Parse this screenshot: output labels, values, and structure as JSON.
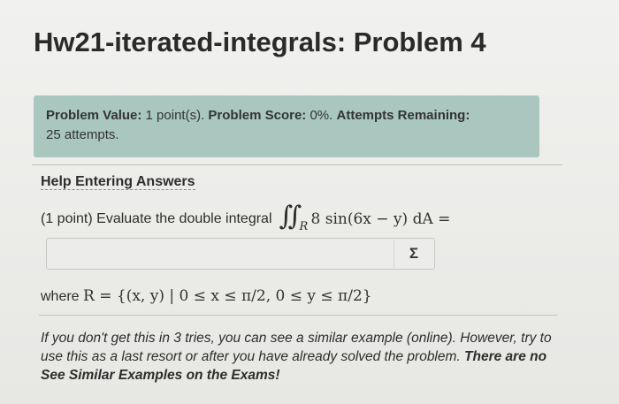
{
  "problem": {
    "title": "Hw21-iterated-integrals: Problem 4",
    "status": {
      "value_label": "Problem Value:",
      "value": "1 point(s).",
      "score_label": "Problem Score:",
      "score": "0%.",
      "attempts_label": "Attempts Remaining:",
      "attempts": "25 attempts."
    },
    "help_link": "Help Entering Answers",
    "question_prefix": "(1 point) Evaluate the double integral",
    "integrand": "8 sin(6x − y) dA =",
    "integral_region_symbol": "R",
    "answer_value": "",
    "equation_editor_symbol": "Σ",
    "where_prefix": "where",
    "region_definition": "R = {(x, y) | 0 ≤ x ≤ π/2, 0 ≤ y ≤ π/2}",
    "note_line": "If you don't get this in 3 tries, you can see a similar example (online). However, try to use this as a last resort or after you have already solved the problem.",
    "note_bold": "There are no See Similar Examples on the Exams!"
  }
}
